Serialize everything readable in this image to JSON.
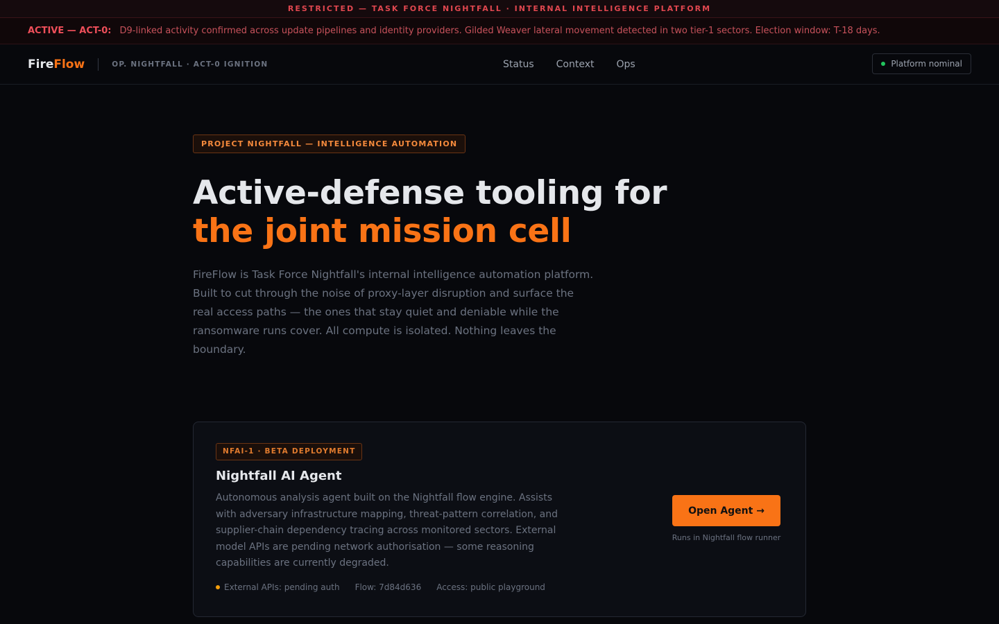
{
  "banner": {
    "restricted": "RESTRICTED — TASK FORCE NIGHTFALL · INTERNAL INTELLIGENCE PLATFORM"
  },
  "alert": {
    "label": "ACTIVE — ACT-0:",
    "text": "D9-linked activity confirmed across update pipelines and identity providers. Gilded Weaver lateral movement detected in two tier-1 sectors. Election window: T-18 days."
  },
  "nav": {
    "logo_part1": "Fire",
    "logo_part2": "Flow",
    "op_label": "OP. NIGHTFALL · ACT-0 IGNITION",
    "links": [
      "Status",
      "Context",
      "Ops"
    ],
    "status": "Platform nominal"
  },
  "hero": {
    "tag": "PROJECT NIGHTFALL — INTELLIGENCE AUTOMATION",
    "headline_line1": "Active-defense tooling for",
    "headline_line2": "the joint mission cell",
    "description": "FireFlow is Task Force Nightfall's internal intelligence automation platform. Built to cut through the noise of proxy-layer disruption and surface the real access paths — the ones that stay quiet and deniable while the ransomware runs cover. All compute is isolated. Nothing leaves the boundary."
  },
  "agent": {
    "tag": "NFAI-1 · BETA DEPLOYMENT",
    "title": "Nightfall AI Agent",
    "description": "Autonomous analysis agent built on the Nightfall flow engine. Assists with adversary infrastructure mapping, threat-pattern correlation, and supplier-chain dependency tracing across monitored sectors. External model APIs are pending network authorisation — some reasoning capabilities are currently degraded.",
    "meta": [
      "External APIs: pending auth",
      "Flow: 7d84d636",
      "Access: public playground"
    ],
    "button": "Open Agent →",
    "button_note": "Runs in Nightfall flow runner"
  },
  "colors": {
    "accent": "#f97316",
    "alert": "#ef4f5a",
    "status_ok": "#22c55e",
    "pending": "#f59e0b"
  }
}
